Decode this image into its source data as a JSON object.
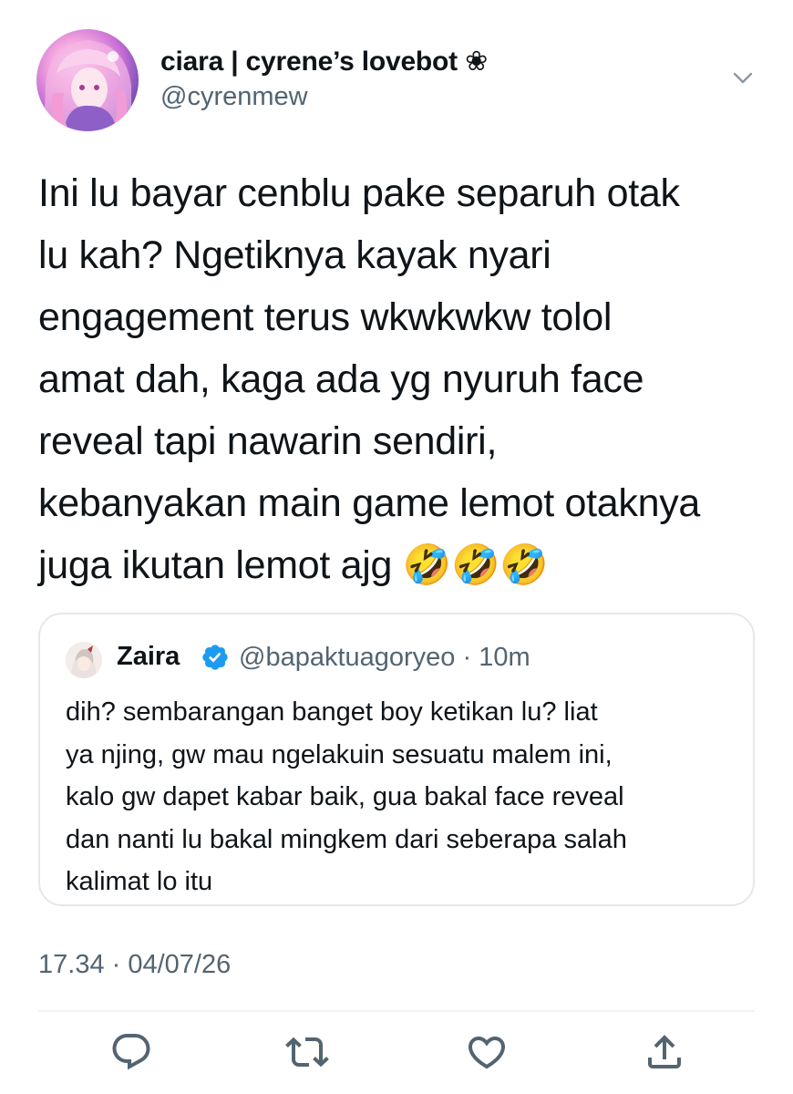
{
  "author": {
    "display_name": "ciara | cyrene’s lovebot ❀",
    "handle": "@cyrenmew"
  },
  "tweet": {
    "text": "Ini lu bayar cenblu pake separuh otak\nlu kah? Ngetiknya kayak nyari\nengagement terus wkwkwkw tolol\namat dah, kaga ada yg nyuruh face\nreveal tapi nawarin sendiri,\nkebanyakan main game lemot otaknya\njuga ikutan lemot ajg 🤣🤣🤣",
    "timestamp": "17.34 · 04/07/26"
  },
  "quoted_tweet": {
    "display_name": "Zaira",
    "meta": "@bapaktuagoryeo · 10m",
    "text": "dih? sembarangan banget boy ketikan lu? liat\nya njing, gw mau ngelakuin sesuatu malem ini,\nkalo gw dapet kabar baik, gua bakal face reveal\ndan nanti lu bakal mingkem dari seberapa salah\nkalimat lo itu"
  },
  "actions": {
    "reply_icon": "reply-icon",
    "retweet_icon": "retweet-icon",
    "like_icon": "heart-icon",
    "share_icon": "share-icon"
  },
  "colors": {
    "text": "#0f1419",
    "secondary": "#536471",
    "verified": "#1d9bf0",
    "border": "#e3e8ec"
  }
}
